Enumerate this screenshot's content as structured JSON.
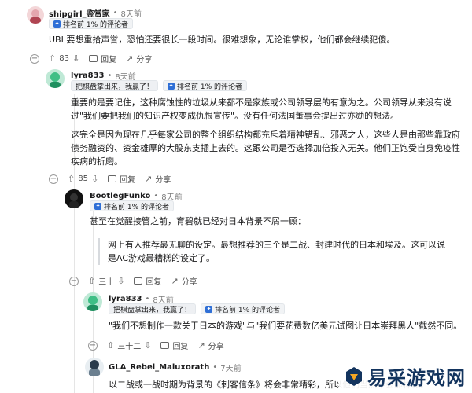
{
  "comments": [
    {
      "username": "shipgirl_鉴赏家",
      "time": "8天前",
      "flairs": [
        {
          "text": "排名前 1% 的评论者",
          "icon": "rank-icon"
        }
      ],
      "body": "UBI 要想重拾声誉，恐怕还要很长一段时间。很难想象，无论谁掌权，他们都会继续犯傻。",
      "actions": {
        "upvotes": "83",
        "reply": "回复",
        "share": "分享"
      }
    },
    {
      "username": "lyra833",
      "time": "8天前",
      "flairs": [
        {
          "text": "把棋盘掌出来，我赢了！",
          "icon": "rank-icon"
        },
        {
          "text": "排名前 1% 的评论者",
          "icon": "rank-icon"
        }
      ],
      "body_paragraphs": [
        "重要的是要记住，这种腐蚀性的垃圾从来都不是家族或公司领导层的有意为之。公司领导从来没有说过\"我们要把我们的知识产权变成仇恨宣传\"。没有任何法国董事会提出过亦勋的想法。",
        "这完全是因为现在几乎每家公司的整个组织结构都充斥着精神错乱、邪恶之人，这些人是由那些靠政府债务融资的、资金雄厚的大股东支插上去的。这跟公司是否选择加倍投入无关。他们正饱受自身免疫性疾病的折磨。"
      ],
      "actions": {
        "upvotes": "85",
        "reply": "回复",
        "share": "分享"
      }
    },
    {
      "username": "BootlegFunko",
      "time": "8天前",
      "flairs": [
        {
          "text": "排名前 1% 的评论者",
          "icon": "rank-icon"
        }
      ],
      "body": "甚至在觉醒接管之前，育碧就已经对日本背景不屑一顾：",
      "quote": "网上有人推荐最无聊的设定。最想推荐的三个是二战、封建时代的日本和埃及。这可以说是AC游戏最糟糕的设定了。",
      "actions": {
        "upvotes": "三十",
        "reply": "回复",
        "share": "分享"
      }
    },
    {
      "username": "lyra833",
      "time": "8天前",
      "flairs": [
        {
          "text": "把棋盘掌出来，我赢了！",
          "icon": "rank-icon"
        },
        {
          "text": "排名前 1% 的评论者",
          "icon": "rank-icon"
        }
      ],
      "body": "\"我们不想制作一款关于日本的游戏\"与\"我们要花费数亿美元试图让日本崇拜黑人\"截然不同。",
      "actions": {
        "upvotes": "三十二",
        "reply": "回复",
        "share": "分享"
      }
    },
    {
      "username": "GLA_Rebel_Maluxorath",
      "time": "7天前",
      "body": "以二战或一战时期为背景的《刺客信条》将会非常精彩，所以他们当然不会那样做。"
    }
  ],
  "watermark": {
    "text": "易采游戏网"
  },
  "colors": {
    "flair_icon": "#2f6fd6",
    "watermark": "#13345e",
    "thread_line": "#e5e5e5"
  }
}
